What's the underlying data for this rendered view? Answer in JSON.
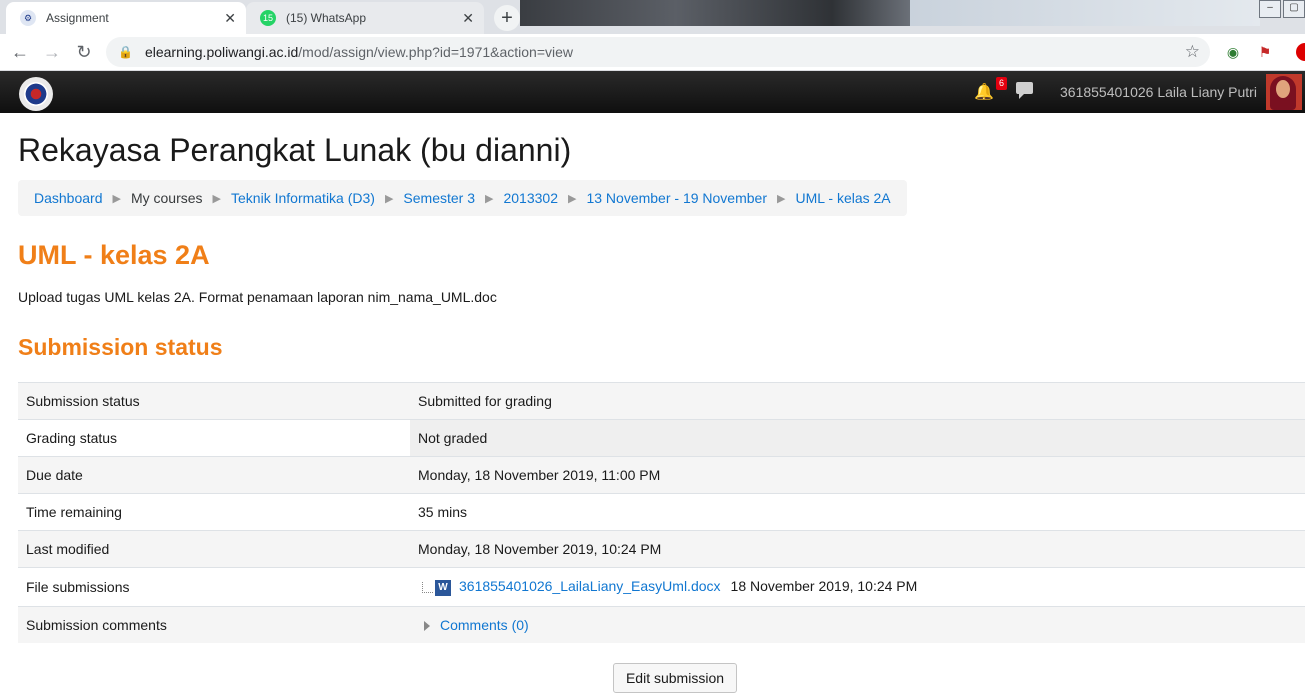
{
  "browser": {
    "tabs": [
      {
        "title": "Assignment",
        "active": true,
        "favicon": "moodle-icon"
      },
      {
        "title": "(15) WhatsApp",
        "active": false,
        "favicon": "whatsapp-icon",
        "badge": "15"
      }
    ],
    "close_glyph": "✕",
    "new_tab_glyph": "+",
    "url_host": "elearning.poliwangi.ac.id",
    "url_path": "/mod/assign/view.php?id=1971&action=view"
  },
  "navbar": {
    "notification_count": "6",
    "user_name": "361855401026 Laila Liany Putri"
  },
  "page": {
    "course_title": "Rekayasa Perangkat Lunak (bu dianni)",
    "breadcrumb": [
      "Dashboard",
      "My courses",
      "Teknik Informatika (D3)",
      "Semester 3",
      "2013302",
      "13 November - 19 November",
      "UML - kelas 2A"
    ],
    "assignment_title": "UML - kelas 2A",
    "intro": "Upload tugas UML kelas 2A. Format penamaan laporan nim_nama_UML.doc",
    "section_title": "Submission status"
  },
  "status_table": {
    "rows": [
      {
        "label": "Submission status",
        "value": "Submitted for grading"
      },
      {
        "label": "Grading status",
        "value": "Not graded"
      },
      {
        "label": "Due date",
        "value": "Monday, 18 November 2019, 11:00 PM"
      },
      {
        "label": "Time remaining",
        "value": "35 mins"
      },
      {
        "label": "Last modified",
        "value": "Monday, 18 November 2019, 10:24 PM"
      },
      {
        "label": "File submissions",
        "file_name": "361855401026_LailaLiany_EasyUml.docx",
        "file_date": "18 November 2019, 10:24 PM"
      },
      {
        "label": "Submission comments",
        "value": "Comments (0)"
      }
    ]
  },
  "actions": {
    "edit_submission": "Edit submission"
  }
}
